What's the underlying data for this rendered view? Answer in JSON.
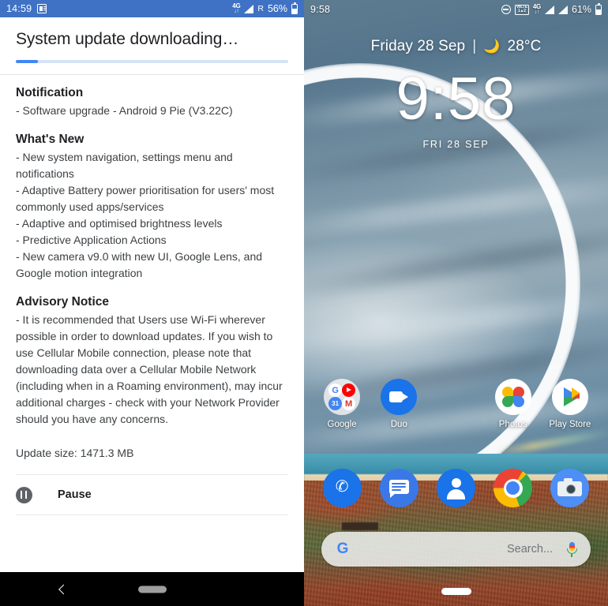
{
  "left_screen": {
    "statusbar": {
      "time": "14:59",
      "news_icon": "news-icon",
      "network_label": "4G",
      "network_arrows": "↓↑",
      "roaming": "R",
      "battery_percent": "56%"
    },
    "title": "System update downloading…",
    "progress_percent": 8,
    "sections": [
      {
        "heading": "Notification",
        "lines": [
          "- Software upgrade - Android 9 Pie (V3.22C)"
        ]
      },
      {
        "heading": "What's New",
        "lines": [
          "- New system navigation, settings menu and notifications",
          "- Adaptive Battery power prioritisation for users' most commonly used apps/services",
          "- Adaptive and optimised brightness levels",
          "- Predictive Application Actions",
          "- New camera v9.0 with new UI, Google Lens, and Google motion integration"
        ]
      },
      {
        "heading": "Advisory Notice",
        "lines": [
          "- It is recommended that Users use Wi-Fi wherever possible in order to download updates. If you wish to use Cellular Mobile connection, please note that downloading data over a Cellular Mobile Network (including when in a Roaming environment), may incur additional charges - check with your Network Provider should you have any concerns."
        ]
      }
    ],
    "update_size": "Update size: 1471.3 MB",
    "pause_label": "Pause",
    "navbar": {
      "back": "back-icon",
      "home": "home-pill"
    }
  },
  "right_screen": {
    "statusbar": {
      "time": "9:58",
      "dnd_icon": "do-not-disturb-icon",
      "volte_line1": "VoLTE",
      "volte_line2": "1▲2",
      "network_label": "4G",
      "network_arrows": "↓↑",
      "battery_percent": "61%"
    },
    "clock_widget": {
      "date_line": "Friday 28 Sep",
      "separator": "|",
      "weather_icon": "🌙",
      "temperature": "28°C",
      "time": "9:58",
      "sub_date": "FRI 28 SEP"
    },
    "app_row": [
      {
        "label": "Google",
        "icon": "google-folder-icon",
        "mini": [
          {
            "name": "google-g-icon",
            "glyph": "G"
          },
          {
            "name": "youtube-icon",
            "glyph": ""
          },
          {
            "name": "calendar-icon",
            "glyph": "31"
          },
          {
            "name": "gmail-icon",
            "glyph": "M"
          }
        ]
      },
      {
        "label": "Duo",
        "icon": "duo-icon"
      },
      {
        "label": "",
        "icon": ""
      },
      {
        "label": "Photos",
        "icon": "photos-icon"
      },
      {
        "label": "Play Store",
        "icon": "play-store-icon"
      }
    ],
    "dock": [
      {
        "label": "Phone",
        "icon": "phone-icon",
        "glyph": "✆"
      },
      {
        "label": "Messages",
        "icon": "messages-icon"
      },
      {
        "label": "Contacts",
        "icon": "contacts-icon"
      },
      {
        "label": "Chrome",
        "icon": "chrome-icon"
      },
      {
        "label": "Camera",
        "icon": "camera-icon"
      }
    ],
    "search": {
      "g_logo": "G",
      "placeholder": "Search...",
      "mic_icon": "microphone-icon"
    },
    "home_pill": "home-pill"
  },
  "colors": {
    "status_blue": "#3f72c4",
    "progress_blue": "#4285f4",
    "progress_track": "#d6e2f5",
    "text_primary": "#202124",
    "text_secondary": "#3c4043"
  }
}
